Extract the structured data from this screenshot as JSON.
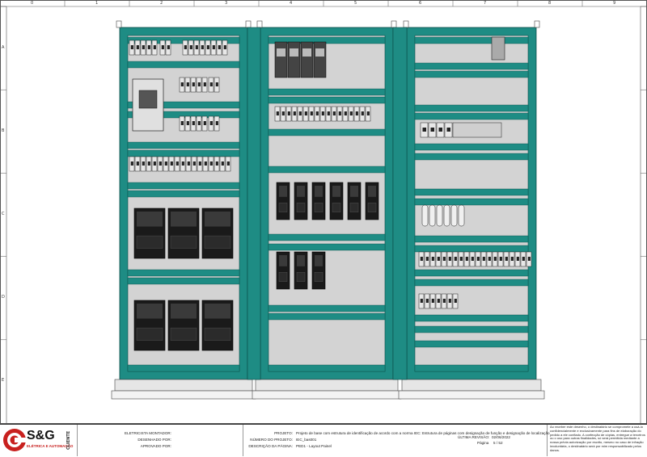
{
  "ruler": {
    "columns": [
      "0",
      "1",
      "2",
      "3",
      "4",
      "5",
      "6",
      "7",
      "8",
      "9"
    ],
    "rows": [
      "A",
      "B",
      "C",
      "D",
      "E"
    ]
  },
  "colors": {
    "frame": "#1e8c84",
    "frame_edge": "#0b4d48",
    "panel": "#d3d3d3",
    "device": "#1a1a1a",
    "terminal": "#e8e8e8",
    "logo_red": "#c8201e"
  },
  "title_block": {
    "logo_name": "S&G",
    "logo_sub": "ELÉTRICA E AUTOMAÇÃO",
    "client_label": "CLIENTE",
    "sign_labels": [
      "ELETRICISTA MONTADOR:",
      "DESENHADO POR:",
      "APROVADO POR:"
    ],
    "project_label": "PROJETO:",
    "project_value": "Projeto de base com estrutura de identificação de acordo com a norma IEC: Estrutura de páginas com designação de função e designação de localização",
    "project_number_label": "NÚMERO DO PROJETO:",
    "project_number_value": "IEC_bas001",
    "page_desc_label": "DESCRIÇÃO DA PÁGINA:",
    "page_desc_value": "PED1 - Layout Painel",
    "last_revision_label": "ÚLTIMA REVISÃO:",
    "last_revision_value": "02/06/2022",
    "page_label": "Página",
    "page_value": "5 / 52",
    "notice": "Ao receber este desenho, o destinatário se compromete a usá-lo confidencialmente e exclusivamente para fins de elaboração do pedido a ele confiado. A confecção de cópias, entregue a terceiros ou o uso para outras finalidades, só será permitida mediante a nossa prévia autorização por escrito, mesmo no caso de infração involuntária, o destinatário será por mim responsabilizado pelos danos."
  }
}
